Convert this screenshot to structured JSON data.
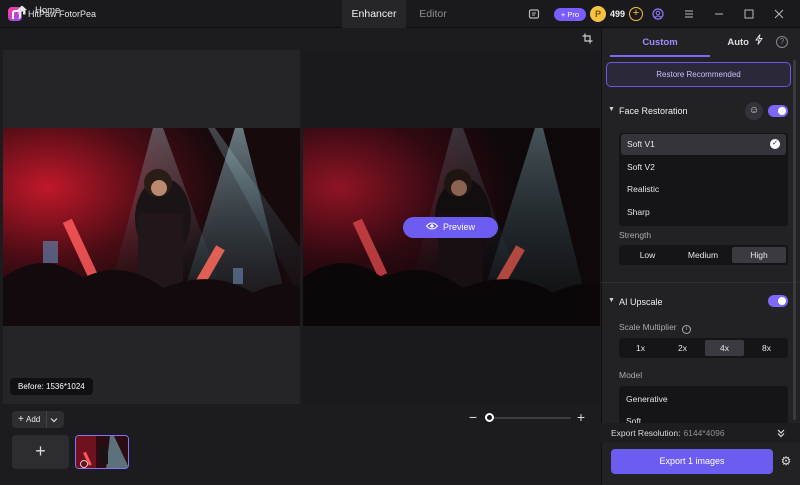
{
  "app": {
    "title": "HitPaw FotorPea"
  },
  "tabs": {
    "enhancer": "Enhancer",
    "editor": "Editor"
  },
  "header": {
    "pro_label": "+ Pro",
    "coins": "499"
  },
  "nav": {
    "home_label": "Home"
  },
  "canvas": {
    "preview_label": "Preview",
    "before_label": "Before: 1536*1024"
  },
  "bottom": {
    "add_label": "Add"
  },
  "panel": {
    "tabs": {
      "custom": "Custom",
      "auto": "Auto"
    },
    "restore_label": "Restore Recommended",
    "face_restoration": {
      "title": "Face Restoration",
      "enabled": true,
      "options": [
        "Soft V1",
        "Soft V2",
        "Realistic",
        "Sharp"
      ],
      "selected": "Soft V1",
      "strength_label": "Strength",
      "strength_options": [
        "Low",
        "Medium",
        "High"
      ],
      "strength_selected": "High"
    },
    "ai_upscale": {
      "title": "AI Upscale",
      "enabled": true,
      "scale_label": "Scale Multiplier",
      "scale_options": [
        "1x",
        "2x",
        "4x",
        "8x"
      ],
      "scale_selected": "4x",
      "model_label": "Model",
      "models": [
        "Generative",
        "Soft"
      ]
    },
    "export": {
      "resolution_label": "Export Resolution:",
      "resolution_value": "6144*4096",
      "button_label": "Export 1 images"
    }
  },
  "colors": {
    "accent": "#6c5cf0",
    "coin": "#f5c242"
  }
}
